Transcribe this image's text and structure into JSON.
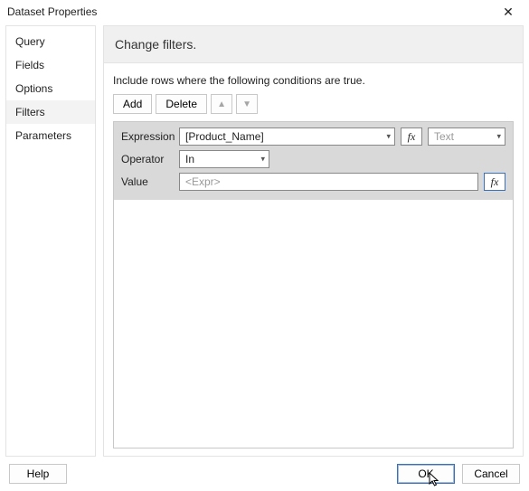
{
  "dialog": {
    "title": "Dataset Properties"
  },
  "sidebar": {
    "items": [
      {
        "label": "Query"
      },
      {
        "label": "Fields"
      },
      {
        "label": "Options"
      },
      {
        "label": "Filters",
        "selected": true
      },
      {
        "label": "Parameters"
      }
    ]
  },
  "main": {
    "header": "Change filters.",
    "instruction": "Include rows where the following conditions are true.",
    "toolbar": {
      "add_label": "Add",
      "delete_label": "Delete"
    },
    "filter": {
      "expression_label": "Expression",
      "expression_value": "[Product_Name]",
      "fx_label": "fx",
      "type_value": "Text",
      "operator_label": "Operator",
      "operator_value": "In",
      "value_label": "Value",
      "value_placeholder": "<Expr>"
    }
  },
  "footer": {
    "help_label": "Help",
    "ok_label": "OK",
    "cancel_label": "Cancel"
  }
}
